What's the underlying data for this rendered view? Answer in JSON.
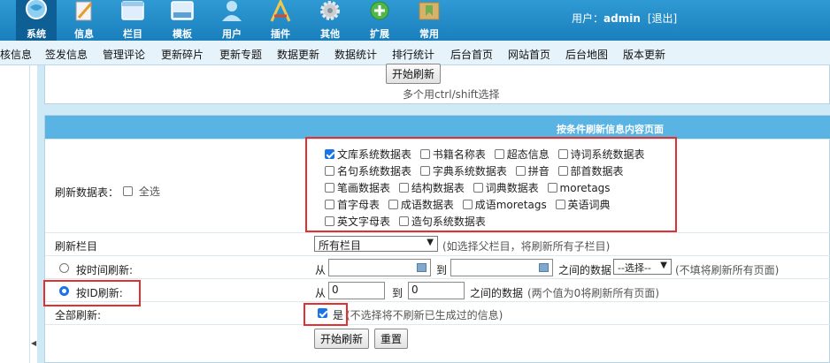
{
  "topbar": {
    "tools": [
      {
        "label": "系统",
        "icon": "system-globe-icon"
      },
      {
        "label": "信息",
        "icon": "info-edit-icon"
      },
      {
        "label": "栏目",
        "icon": "column-window-icon"
      },
      {
        "label": "模板",
        "icon": "template-window-icon"
      },
      {
        "label": "用户",
        "icon": "user-icon"
      },
      {
        "label": "插件",
        "icon": "plugin-tools-icon"
      },
      {
        "label": "其他",
        "icon": "gear-icon"
      },
      {
        "label": "扩展",
        "icon": "extend-plus-icon"
      },
      {
        "label": "常用",
        "icon": "common-folder-icon"
      }
    ],
    "user_prefix": "用户：",
    "user_name": "admin",
    "logout": "[退出]"
  },
  "nav": {
    "items": [
      "核信息",
      "签发信息",
      "管理评论",
      "更新碎片",
      "更新专题",
      "数据更新",
      "数据统计",
      "排行统计",
      "后台首页",
      "网站首页",
      "后台地图",
      "版本更新"
    ]
  },
  "top_section": {
    "start_button": "开始刷新",
    "hint": "多个用ctrl/shift选择"
  },
  "panel": {
    "title": "按条件刷新信息内容页面",
    "refresh_tables_label": "刷新数据表：",
    "select_all": "全选",
    "tables": [
      [
        {
          "name": "文库系统数据表",
          "checked": true
        },
        {
          "name": "书籍名称表",
          "checked": false
        },
        {
          "name": "超态信息",
          "checked": false
        },
        {
          "name": "诗词系统数据表",
          "checked": false
        }
      ],
      [
        {
          "name": "名句系统数据表",
          "checked": false
        },
        {
          "name": "字典系统数据表",
          "checked": false
        },
        {
          "name": "拼音",
          "checked": false
        },
        {
          "name": "部首数据表",
          "checked": false
        }
      ],
      [
        {
          "name": "笔画数据表",
          "checked": false
        },
        {
          "name": "结构数据表",
          "checked": false
        },
        {
          "name": "词典数据表",
          "checked": false
        },
        {
          "name": "moretags",
          "checked": false
        }
      ],
      [
        {
          "name": "首字母表",
          "checked": false
        },
        {
          "name": "成语数据表",
          "checked": false
        },
        {
          "name": "成语moretags",
          "checked": false
        },
        {
          "name": "英语词典",
          "checked": false
        }
      ],
      [
        {
          "name": "英文字母表",
          "checked": false
        },
        {
          "name": "造句系统数据表",
          "checked": false
        }
      ]
    ],
    "column_label": "刷新栏目",
    "column_select": "所有栏目",
    "column_note": "(如选择父栏目，将刷新所有子栏目)",
    "time_label": "按时间刷新:",
    "time_from": "从",
    "time_to": "到",
    "time_between": "之间的数据",
    "time_select": "--选择--",
    "time_note": "(不填将刷新所有页面)",
    "id_label": "按ID刷新:",
    "id_from": "从",
    "id_from_value": "0",
    "id_to": "到",
    "id_to_value": "0",
    "id_between": "之间的数据",
    "id_note": "(两个值为0将刷新所有页面)",
    "full_label": "全部刷新:",
    "full_yes": "是",
    "full_note": "(不选择将不刷新已生成过的信息)",
    "start_button": "开始刷新",
    "reset_button": "重置"
  }
}
